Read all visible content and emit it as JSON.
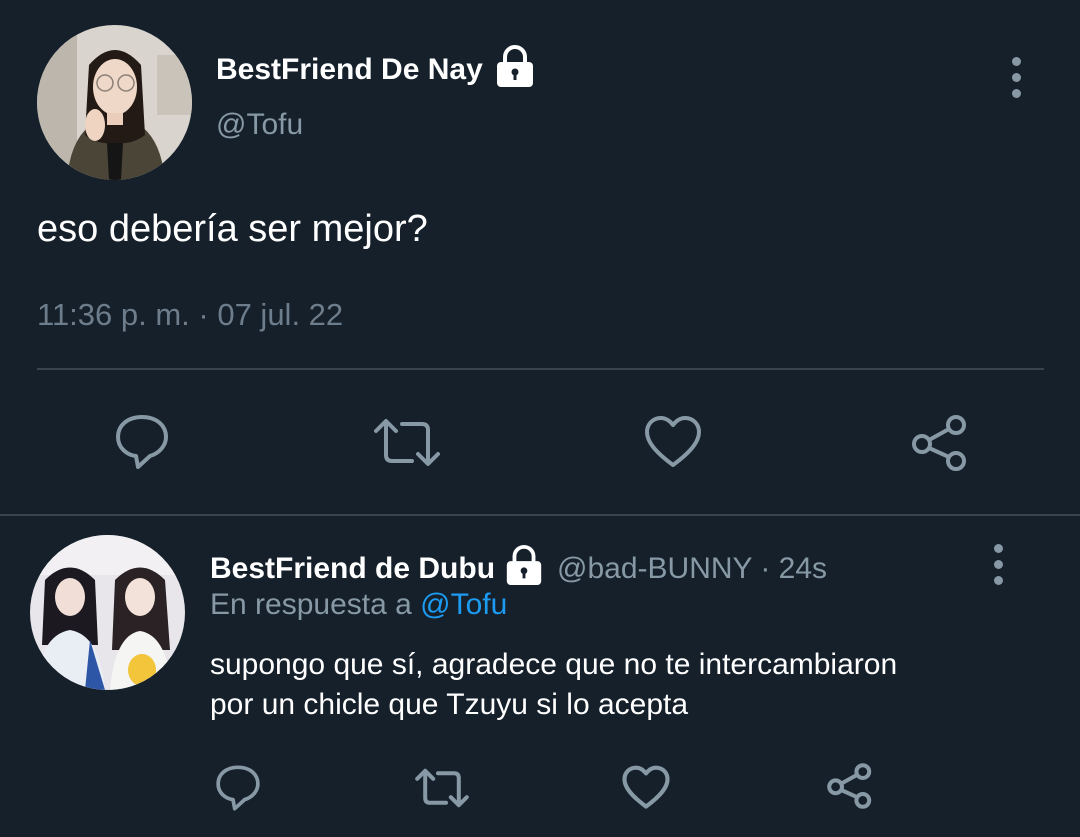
{
  "main_tweet": {
    "display_name": "BestFriend De Nay",
    "handle": "@Tofu",
    "text": "eso debería ser mejor?",
    "timestamp": "11:36 p. m. · 07 jul. 22",
    "protected": true
  },
  "reply_tweet": {
    "display_name": "BestFriend de Dubu",
    "handle_time": "@bad-BUNNY · 24s",
    "reply_prefix": "En respuesta a",
    "reply_to": "@Tofu",
    "text_line1": "supongo que sí, agradece que no te intercambiaron",
    "text_line2": "por un chicle que Tzuyu si lo acepta",
    "protected": true
  },
  "icons": [
    "reply-icon",
    "retweet-icon",
    "like-icon",
    "share-icon",
    "more-icon",
    "lock-icon"
  ],
  "colors": {
    "background": "#15202b",
    "text_primary": "#ffffff",
    "text_secondary": "#8899a6",
    "link": "#1d9bf0",
    "divider": "#38444d"
  }
}
